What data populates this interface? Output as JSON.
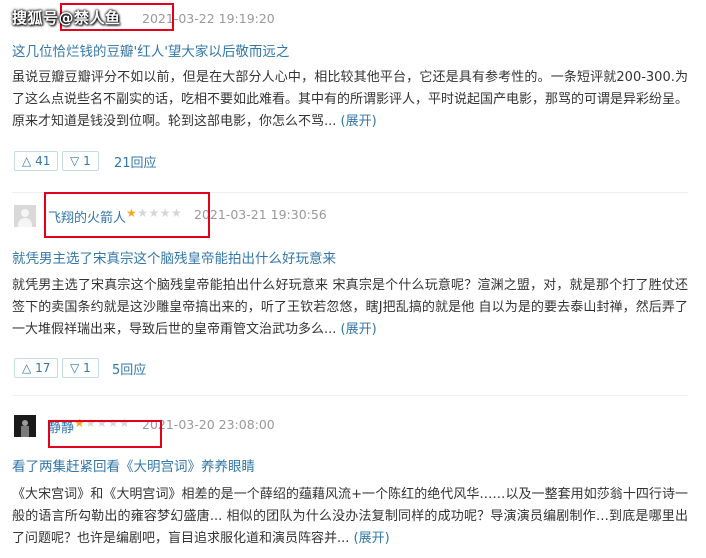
{
  "watermark": "搜狐号@禁人鱼",
  "reviews": [
    {
      "user": "",
      "stars_on": "",
      "stars_off": "",
      "date": "2021-03-22 19:19:20",
      "title": "这几位恰烂钱的豆瓣'红人'望大家以后敬而远之",
      "content": "虽说豆瓣豆瓣评分不如以前，但是在大部分人心中，相比较其他平台，它还是具有参考性的。一条短评就200-300.为了这么点说些名不副实的话，吃相不要如此难看。其中有的所谓影评人，平时说起国产电影，那骂的可谓是异彩纷呈。原来才知道是钱没到位啊。轮到这部电影，你怎么不骂...",
      "expand": "(展开)",
      "up": "41",
      "down": "1",
      "replies": "21回应"
    },
    {
      "user": "飞翔的火箭人",
      "stars_on": "★",
      "stars_off": "★★★★",
      "date": "2021-03-21 19:30:56",
      "title": "就凭男主选了宋真宗这个脑残皇帝能拍出什么好玩意来",
      "content": "就凭男主选了宋真宗这个脑残皇帝能拍出什么好玩意来 宋真宗是个什么玩意呢？渲渊之盟，对，就是那个打了胜仗还签下的卖国条约就是这沙雕皇帝搞出来的，听了王钦若忽悠，瞎J把乱搞的就是他 自以为是的要去泰山封禅，然后弄了一大堆假祥瑞出来，导致后世的皇帝甭管文治武功多么...",
      "expand": "(展开)",
      "up": "17",
      "down": "1",
      "replies": "5回应"
    },
    {
      "user": "静静",
      "stars_on": "★",
      "stars_off": "★★★★",
      "date": "2021-03-20 23:08:00",
      "title": "看了两集赶紧回看《大明宫词》养养眼睛",
      "content": "《大宋宫词》和《大明宫词》相差的是一个薛绍的蕴藉风流+一个陈红的绝代风华……以及一整套用如莎翁十四行诗一般的语言所勾勒出的雍容梦幻盛唐... 相似的团队为什么没办法复制同样的成功呢？导演演员编剧制作…到底是哪里出了问题呢？也许是编剧吧，盲目追求服化道和演员阵容并...",
      "expand": "(展开)"
    }
  ],
  "icons": {
    "up": "△",
    "down": "▽"
  },
  "colors": {
    "link": "#3377aa",
    "star": "#f6a623",
    "highlight": "#e2001a"
  }
}
